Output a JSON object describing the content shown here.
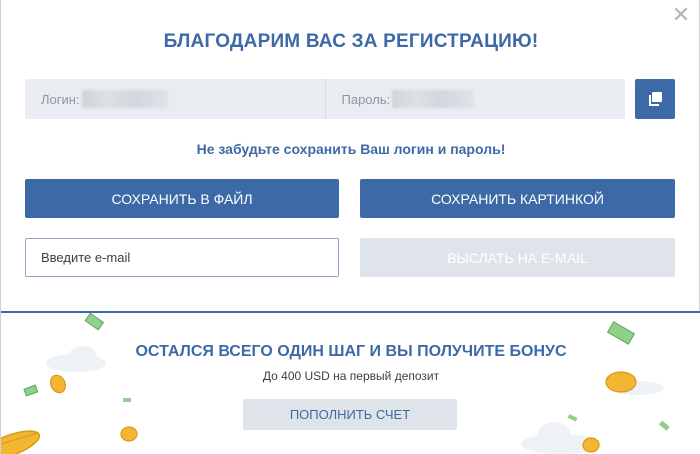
{
  "modal": {
    "title": "БЛАГОДАРИМ ВАС ЗА РЕГИСТРАЦИЮ!",
    "close_icon": "close-icon",
    "login_label": "Логин:",
    "password_label": "Пароль:",
    "copy_icon": "copy-icon",
    "reminder": "Не забудьте сохранить Ваш логин и пароль!",
    "save_file_label": "СОХРАНИТЬ В ФАЙЛ",
    "save_image_label": "СОХРАНИТЬ КАРТИНКОЙ",
    "email_placeholder": "Введите e-mail",
    "send_email_label": "ВЫСЛАТЬ НА E-MAIL"
  },
  "bonus": {
    "title": "ОСТАЛСЯ ВСЕГО ОДИН ШАГ И ВЫ ПОЛУЧИТЕ БОНУС",
    "subtitle": "До 400 USD на первый депозит",
    "deposit_label": "ПОПОЛНИТЬ СЧЕТ"
  },
  "colors": {
    "accent": "#3d6aa7",
    "disabled": "#dfe4ea",
    "field_bg": "#e9edf2"
  }
}
